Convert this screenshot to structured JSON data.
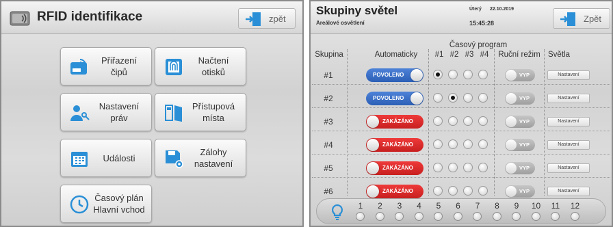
{
  "left_screen": {
    "title": "RFID identifikace",
    "back_label": "zpět",
    "tiles": [
      {
        "label": "Přiřazení\nčipů",
        "icon": "rfid-card-icon"
      },
      {
        "label": "Načtení\notisků",
        "icon": "fingerprint-reader-icon"
      },
      {
        "label": "Nastavení\npráv",
        "icon": "users-key-icon"
      },
      {
        "label": "Přístupová\nmísta",
        "icon": "door-icon"
      },
      {
        "label": "Události",
        "icon": "calendar-icon"
      },
      {
        "label": "Zálohy\nnastavení",
        "icon": "save-settings-icon"
      },
      {
        "label": "Časový plán\nHlavní vchod",
        "icon": "clock-icon"
      }
    ]
  },
  "right_screen": {
    "title": "Skupiny světel",
    "subtitle": "Areálové osvětlení",
    "day": "Úterý",
    "date": "22.10.2019",
    "time": "15:45:28",
    "back_label": "Zpět",
    "program_header": "Časový program",
    "columns": {
      "group": "Skupina",
      "auto": "Automaticky",
      "p1": "#1",
      "p2": "#2",
      "p3": "#3",
      "p4": "#4",
      "manual": "Ruční režim",
      "lights": "Světla"
    },
    "rows": [
      {
        "group": "#1",
        "auto": "POVOLENO",
        "auto_enabled": true,
        "program": 1,
        "manual": "VYP",
        "lights": "Nastavení"
      },
      {
        "group": "#2",
        "auto": "POVOLENO",
        "auto_enabled": true,
        "program": 2,
        "manual": "VYP",
        "lights": "Nastavení"
      },
      {
        "group": "#3",
        "auto": "ZAKÁZÁNO",
        "auto_enabled": false,
        "program": 0,
        "manual": "VYP",
        "lights": "Nastavení"
      },
      {
        "group": "#4",
        "auto": "ZAKÁZÁNO",
        "auto_enabled": false,
        "program": 0,
        "manual": "VYP",
        "lights": "Nastavení"
      },
      {
        "group": "#5",
        "auto": "ZAKÁZÁNO",
        "auto_enabled": false,
        "program": 0,
        "manual": "VYP",
        "lights": "Nastavení"
      },
      {
        "group": "#6",
        "auto": "ZAKÁZÁNO",
        "auto_enabled": false,
        "program": 0,
        "manual": "VYP",
        "lights": "Nastavení"
      }
    ],
    "lamps": [
      "1",
      "2",
      "3",
      "4",
      "5",
      "6",
      "7",
      "8",
      "9",
      "10",
      "11",
      "12"
    ],
    "colors": {
      "enabled": "#2c5fb6",
      "disabled": "#c81f1f",
      "accent": "#2a8fd6"
    }
  }
}
